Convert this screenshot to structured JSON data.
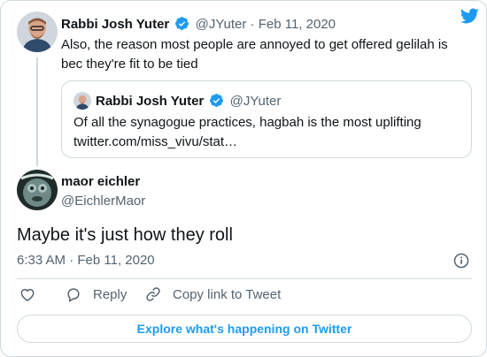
{
  "colors": {
    "accent": "#1d9bf0",
    "muted": "#536471",
    "border": "#cfd9de"
  },
  "parent_tweet": {
    "name": "Rabbi Josh Yuter",
    "handle": "@JYuter",
    "separator": "·",
    "date": "Feb 11, 2020",
    "text": "Also, the reason most people are annoyed to get offered gelilah is bec they're fit to be tied"
  },
  "quoted_tweet": {
    "name": "Rabbi Josh Yuter",
    "handle": "@JYuter",
    "text_line1": "Of all the synagogue practices, hagbah is the most uplifting",
    "text_line2": "twitter.com/miss_vivu/stat…"
  },
  "main_tweet": {
    "name": "maor eichler",
    "handle": "@EichlerMaor",
    "text": "Maybe it's just how they roll",
    "timestamp": "6:33 AM · Feb 11, 2020"
  },
  "actions": {
    "like_icon": "heart-icon",
    "reply_label": "Reply",
    "copy_link_label": "Copy link to Tweet"
  },
  "explore_label": "Explore what's happening on Twitter"
}
